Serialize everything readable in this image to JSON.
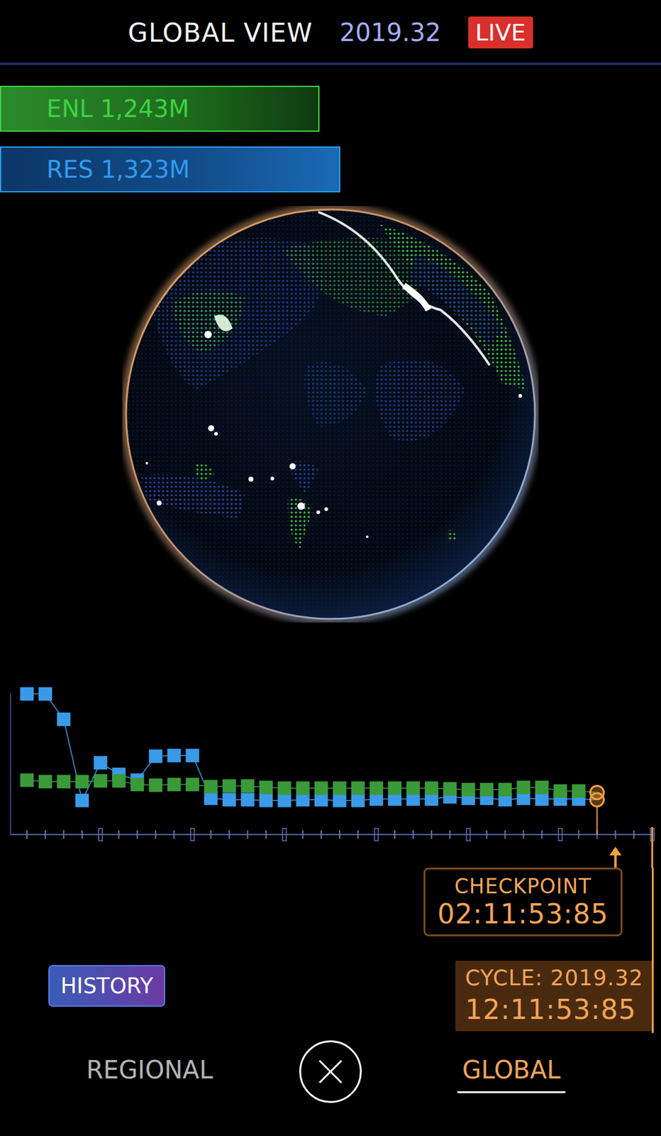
{
  "header": {
    "title": "GLOBAL VIEW",
    "cycle": "2019.32",
    "badge": "LIVE"
  },
  "scores": [
    {
      "label": "ENL 1,243M",
      "level": 0.483,
      "color": "#3fd23f"
    },
    {
      "label": "RES 1,323M",
      "level": 0.515,
      "color": "#2f9bf0"
    }
  ],
  "chart": {
    "checkpoints": 35,
    "current_checkpoint": 33,
    "series": [
      {
        "name": "RES",
        "color": "#3a9ae8",
        "values": [
          194,
          194,
          159,
          47,
          99,
          83,
          75,
          108,
          109,
          109,
          50,
          48,
          48,
          47,
          47,
          48,
          48,
          47,
          47,
          49,
          49,
          49,
          49,
          52,
          50,
          50,
          48,
          50,
          49,
          49,
          49,
          48
        ]
      },
      {
        "name": "ENL",
        "color": "#3a9a3a",
        "values": [
          75,
          73,
          73,
          73,
          74,
          74,
          69,
          68,
          69,
          69,
          66,
          67,
          67,
          65,
          64,
          64,
          64,
          64,
          64,
          64,
          64,
          64,
          64,
          63,
          62,
          62,
          62,
          65,
          65,
          60,
          60,
          58
        ]
      }
    ]
  },
  "checkpoint": {
    "label": "CHECKPOINT",
    "time": "02:11:53:85"
  },
  "cycle": {
    "label": "CYCLE: 2019.32",
    "time": "12:11:53:85"
  },
  "history_button": "HISTORY",
  "tabs": [
    {
      "label": "REGIONAL",
      "selected": false
    },
    {
      "label": "GLOBAL",
      "selected": true
    }
  ]
}
